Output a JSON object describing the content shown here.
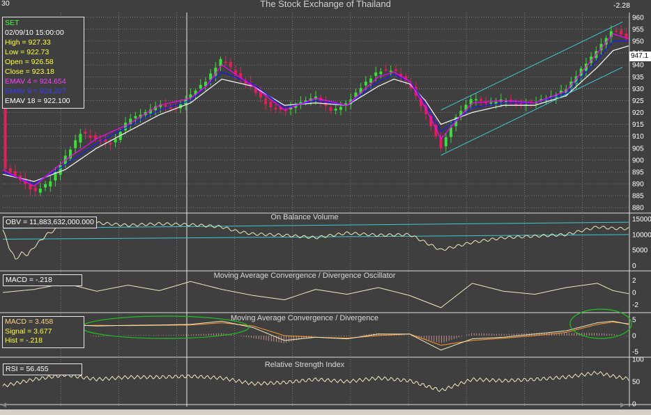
{
  "header": {
    "title": "The Stock Exchange of Thailand",
    "period": "30",
    "change": "-2.28",
    "last_price": "947.1"
  },
  "info": {
    "symbol": "SET",
    "datetime": "02/09/10 15:00:00",
    "high": "High  = 927.33",
    "low": "Low   = 922.73",
    "open": "Open = 926.58",
    "close": "Close = 923.18",
    "emav4": "EMAV 4 = 924.654",
    "emav9": "EMAV 9 = 924.207",
    "emav18": "EMAV 18 = 922.100"
  },
  "panes": {
    "obv": {
      "title": "On Balance Volume",
      "label": "OBV = 11,883,632,000.000",
      "ticks": [
        "15000",
        "10000",
        "5000",
        "0"
      ]
    },
    "macd_osc": {
      "title": "Moving Average Convergence / Divergence Oscillator",
      "label": "MACD = -.218",
      "ticks": [
        "2",
        "0",
        "-2"
      ]
    },
    "macd": {
      "title": "Moving Average Convergence / Divergence",
      "macd": "MACD = 3.458",
      "signal": "Signal = 3.677",
      "hist": "Hist = -.218",
      "ticks": [
        "5",
        "0",
        "-5"
      ]
    },
    "rsi": {
      "title": "Relative Strength Index",
      "label": "RSI = 56.455",
      "ticks": [
        "100",
        "50",
        "0"
      ]
    }
  },
  "colors": {
    "background": "#3f3f3f",
    "grid": "#9a9a9a",
    "up_candle": "#38e038",
    "down_candle": "#e0205a",
    "emav4": "#ff00ff",
    "emav9": "#1a1aff",
    "emav18": "#ffffff",
    "channel": "#3ec8d0",
    "indicator_line": "#f0ecc0",
    "ellipse": "#20c020",
    "signal_line": "#ff9a30"
  },
  "chart_data": {
    "type": "candlestick",
    "title": "The Stock Exchange of Thailand",
    "price_axis": {
      "ylim": [
        878,
        962
      ],
      "ticks": [
        880,
        885,
        890,
        895,
        900,
        905,
        910,
        915,
        920,
        925,
        930,
        935,
        940,
        945,
        950,
        955,
        960
      ]
    },
    "price_path": [
      [
        0,
        897
      ],
      [
        5,
        892
      ],
      [
        10,
        886
      ],
      [
        15,
        891
      ],
      [
        20,
        902
      ],
      [
        25,
        912
      ],
      [
        30,
        908
      ],
      [
        35,
        906
      ],
      [
        40,
        917
      ],
      [
        45,
        920
      ],
      [
        50,
        924
      ],
      [
        55,
        921
      ],
      [
        60,
        927
      ],
      [
        65,
        933
      ],
      [
        70,
        943
      ],
      [
        75,
        936
      ],
      [
        80,
        930
      ],
      [
        85,
        922
      ],
      [
        90,
        920
      ],
      [
        95,
        924
      ],
      [
        100,
        927
      ],
      [
        105,
        921
      ],
      [
        110,
        924
      ],
      [
        115,
        931
      ],
      [
        120,
        937
      ],
      [
        125,
        938
      ],
      [
        130,
        932
      ],
      [
        135,
        920
      ],
      [
        140,
        905
      ],
      [
        145,
        918
      ],
      [
        150,
        926
      ],
      [
        155,
        924
      ],
      [
        160,
        926
      ],
      [
        165,
        923
      ],
      [
        170,
        924
      ],
      [
        175,
        926
      ],
      [
        180,
        930
      ],
      [
        185,
        939
      ],
      [
        190,
        947
      ],
      [
        195,
        955
      ],
      [
        200,
        950
      ]
    ],
    "emav4": [
      [
        0,
        896
      ],
      [
        10,
        889
      ],
      [
        20,
        900
      ],
      [
        30,
        909
      ],
      [
        40,
        915
      ],
      [
        50,
        923
      ],
      [
        60,
        926
      ],
      [
        65,
        931
      ],
      [
        70,
        940
      ],
      [
        80,
        931
      ],
      [
        90,
        921
      ],
      [
        100,
        926
      ],
      [
        110,
        923
      ],
      [
        120,
        935
      ],
      [
        125,
        937
      ],
      [
        130,
        933
      ],
      [
        135,
        922
      ],
      [
        140,
        909
      ],
      [
        150,
        924
      ],
      [
        160,
        925
      ],
      [
        170,
        924
      ],
      [
        180,
        929
      ],
      [
        190,
        945
      ],
      [
        195,
        953
      ],
      [
        200,
        951
      ]
    ],
    "emav9": [
      [
        0,
        895
      ],
      [
        10,
        890
      ],
      [
        20,
        898
      ],
      [
        30,
        907
      ],
      [
        40,
        914
      ],
      [
        50,
        921
      ],
      [
        60,
        925
      ],
      [
        70,
        937
      ],
      [
        80,
        932
      ],
      [
        90,
        922
      ],
      [
        100,
        925
      ],
      [
        110,
        923
      ],
      [
        120,
        933
      ],
      [
        125,
        936
      ],
      [
        130,
        933
      ],
      [
        135,
        924
      ],
      [
        140,
        912
      ],
      [
        150,
        922
      ],
      [
        160,
        924
      ],
      [
        170,
        924
      ],
      [
        180,
        928
      ],
      [
        190,
        942
      ],
      [
        195,
        950
      ],
      [
        200,
        950
      ]
    ],
    "emav18": [
      [
        0,
        894
      ],
      [
        10,
        891
      ],
      [
        20,
        896
      ],
      [
        30,
        905
      ],
      [
        40,
        912
      ],
      [
        50,
        919
      ],
      [
        60,
        924
      ],
      [
        70,
        934
      ],
      [
        80,
        931
      ],
      [
        90,
        923
      ],
      [
        100,
        924
      ],
      [
        110,
        923
      ],
      [
        120,
        931
      ],
      [
        125,
        934
      ],
      [
        130,
        932
      ],
      [
        135,
        925
      ],
      [
        140,
        915
      ],
      [
        150,
        920
      ],
      [
        160,
        923
      ],
      [
        170,
        923
      ],
      [
        180,
        927
      ],
      [
        190,
        939
      ],
      [
        195,
        946
      ],
      [
        200,
        948
      ]
    ],
    "channel": {
      "upper": [
        [
          140,
          921
        ],
        [
          198,
          958
        ]
      ],
      "lower": [
        [
          140,
          902
        ],
        [
          198,
          939
        ]
      ]
    },
    "obv": {
      "ylim": [
        -1500,
        16500
      ],
      "ticks": [
        15000,
        10000,
        5000,
        0
      ],
      "path": [
        [
          0,
          11500
        ],
        [
          2,
          6000
        ],
        [
          4,
          2000
        ],
        [
          6,
          4000
        ],
        [
          8,
          3500
        ],
        [
          10,
          6000
        ],
        [
          14,
          10000
        ],
        [
          20,
          13500
        ],
        [
          30,
          13800
        ],
        [
          40,
          13000
        ],
        [
          50,
          13500
        ],
        [
          60,
          13200
        ],
        [
          70,
          12500
        ],
        [
          75,
          11000
        ],
        [
          80,
          10200
        ],
        [
          90,
          9800
        ],
        [
          100,
          9000
        ],
        [
          110,
          10500
        ],
        [
          120,
          9800
        ],
        [
          130,
          10000
        ],
        [
          140,
          5000
        ],
        [
          150,
          7500
        ],
        [
          160,
          9000
        ],
        [
          170,
          9500
        ],
        [
          180,
          10000
        ],
        [
          190,
          12500
        ],
        [
          195,
          12000
        ],
        [
          200,
          11900
        ]
      ],
      "channel": [
        [
          [
            0,
            12000
          ],
          [
            200,
            14000
          ]
        ],
        [
          [
            0,
            8500
          ],
          [
            200,
            10000
          ]
        ]
      ]
    },
    "macd_osc": {
      "ylim": [
        -3.2,
        3.2
      ],
      "ticks": [
        2,
        0,
        -2
      ],
      "path": [
        [
          0,
          0
        ],
        [
          10,
          0.5
        ],
        [
          20,
          1.5
        ],
        [
          30,
          0.2
        ],
        [
          40,
          1.2
        ],
        [
          50,
          0.3
        ],
        [
          60,
          1.8
        ],
        [
          70,
          0.5
        ],
        [
          80,
          -0.5
        ],
        [
          90,
          -1.2
        ],
        [
          100,
          0.5
        ],
        [
          110,
          -0.3
        ],
        [
          120,
          0.8
        ],
        [
          130,
          -0.5
        ],
        [
          140,
          -2.5
        ],
        [
          150,
          1.5
        ],
        [
          160,
          0.2
        ],
        [
          170,
          -0.3
        ],
        [
          180,
          0.8
        ],
        [
          190,
          1.5
        ],
        [
          195,
          0.3
        ],
        [
          200,
          -0.2
        ]
      ]
    },
    "macd": {
      "ylim": [
        -6.5,
        6.5
      ],
      "ticks": [
        5,
        0,
        -5
      ],
      "macd_line": [
        [
          0,
          0
        ],
        [
          10,
          2
        ],
        [
          20,
          3.5
        ],
        [
          30,
          3
        ],
        [
          40,
          3.2
        ],
        [
          50,
          3.3
        ],
        [
          60,
          3.5
        ],
        [
          70,
          4.5
        ],
        [
          80,
          2.5
        ],
        [
          90,
          -1.5
        ],
        [
          100,
          -0.5
        ],
        [
          110,
          -1
        ],
        [
          120,
          0.5
        ],
        [
          130,
          0.5
        ],
        [
          140,
          -4.5
        ],
        [
          150,
          -1
        ],
        [
          160,
          -0.5
        ],
        [
          170,
          0.5
        ],
        [
          180,
          1.5
        ],
        [
          190,
          4
        ],
        [
          195,
          4.5
        ],
        [
          200,
          3.5
        ]
      ],
      "signal_line": [
        [
          0,
          0.5
        ],
        [
          10,
          1.5
        ],
        [
          20,
          3
        ],
        [
          30,
          3.2
        ],
        [
          40,
          3.1
        ],
        [
          50,
          3.2
        ],
        [
          60,
          3.3
        ],
        [
          70,
          4
        ],
        [
          80,
          3
        ],
        [
          90,
          0
        ],
        [
          100,
          -0.5
        ],
        [
          110,
          -0.8
        ],
        [
          120,
          0
        ],
        [
          130,
          0.5
        ],
        [
          140,
          -3
        ],
        [
          150,
          -1.5
        ],
        [
          160,
          -0.8
        ],
        [
          170,
          0
        ],
        [
          180,
          1
        ],
        [
          190,
          3.5
        ],
        [
          195,
          4.2
        ],
        [
          200,
          3.7
        ]
      ]
    },
    "rsi": {
      "ylim": [
        0,
        100
      ],
      "ticks": [
        100,
        50,
        0
      ],
      "path": [
        [
          0,
          40
        ],
        [
          10,
          55
        ],
        [
          20,
          65
        ],
        [
          30,
          55
        ],
        [
          40,
          60
        ],
        [
          50,
          60
        ],
        [
          60,
          62
        ],
        [
          70,
          58
        ],
        [
          80,
          45
        ],
        [
          90,
          48
        ],
        [
          100,
          55
        ],
        [
          110,
          50
        ],
        [
          120,
          58
        ],
        [
          130,
          52
        ],
        [
          140,
          30
        ],
        [
          150,
          55
        ],
        [
          160,
          52
        ],
        [
          170,
          55
        ],
        [
          180,
          60
        ],
        [
          190,
          70
        ],
        [
          195,
          62
        ],
        [
          200,
          56
        ]
      ]
    }
  }
}
